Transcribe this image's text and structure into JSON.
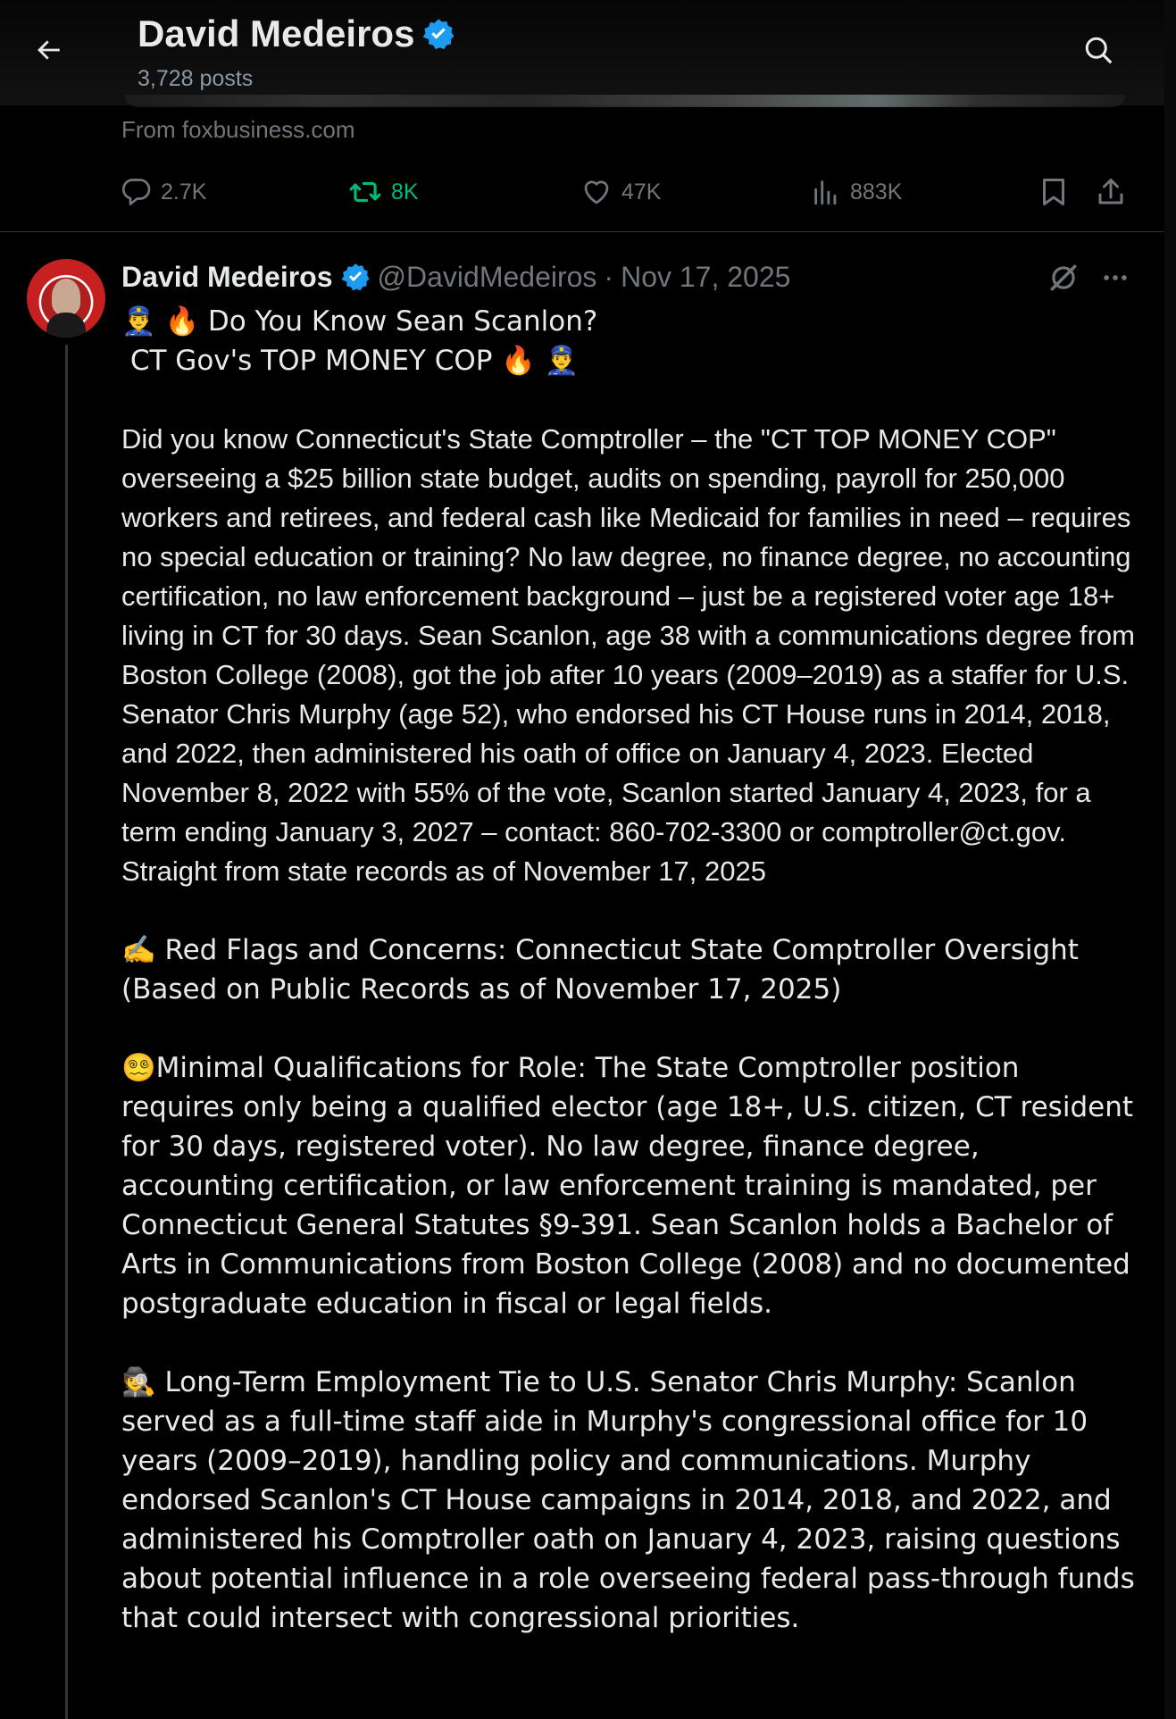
{
  "header": {
    "name": "David Medeiros",
    "posts_count": "3,728 posts"
  },
  "prev_post": {
    "source": "From foxbusiness.com",
    "stats": {
      "replies": "2.7K",
      "reposts": "8K",
      "likes": "47K",
      "views": "883K"
    }
  },
  "post": {
    "author_name": "David Medeiros",
    "handle": "@DavidMedeiros",
    "separator": "·",
    "date": "Nov 17, 2025",
    "lines": {
      "l1": "👮‍♂️ 🔥 Do You Know Sean Scanlon?",
      "l2": " CT Gov's TOP MONEY COP 🔥 👮‍♂️",
      "p1": "Did you know Connecticut's State Comptroller – the \"CT TOP MONEY COP\" overseeing a $25 billion state budget, audits on spending, payroll for 250,000 workers and retirees, and federal cash like Medicaid for families in need – requires no special education or training? No law degree, no finance degree, no accounting certification, no law enforcement background – just be a registered voter age 18+ living in CT for 30 days. Sean Scanlon, age 38 with a communications degree from Boston College (2008), got the job after 10 years (2009–2019) as a staffer for U.S. Senator Chris Murphy (age 52), who endorsed his CT House runs in 2014, 2018, and 2022, then administered his oath of office on January 4, 2023. Elected November 8, 2022 with 55% of the vote, Scanlon started January 4, 2023, for a term ending January 3, 2027 – contact: 860-702-3300 or comptroller@ct.gov. Straight from state records as of November 17, 2025",
      "p2": "✍️ Red Flags and Concerns: Connecticut State Comptroller Oversight (Based on Public Records as of November 17, 2025)",
      "p3": "😵‍💫Minimal Qualifications for Role: The State Comptroller position requires only being a qualified elector (age 18+, U.S. citizen, CT resident for 30 days, registered voter). No law degree, finance degree, accounting certification, or law enforcement training is mandated, per Connecticut General Statutes §9-391. Sean Scanlon holds a Bachelor of Arts in Communications from Boston College (2008) and no documented postgraduate education in fiscal or legal fields.",
      "p4": "🕵️ Long-Term Employment Tie to U.S. Senator Chris Murphy: Scanlon served as a full-time staff aide in Murphy's congressional office for 10 years (2009–2019), handling policy and communications. Murphy endorsed Scanlon's CT House campaigns in 2014, 2018, and 2022, and administered his Comptroller oath on January 4, 2023, raising questions about potential influence in a role overseeing federal pass-through funds that could intersect with congressional priorities."
    }
  },
  "colors": {
    "background": "#000000",
    "text": "#e7e9ea",
    "muted": "#71767b",
    "repost_active": "#00ba7c",
    "verified": "#1d9bf0",
    "divider": "#2f3336"
  }
}
